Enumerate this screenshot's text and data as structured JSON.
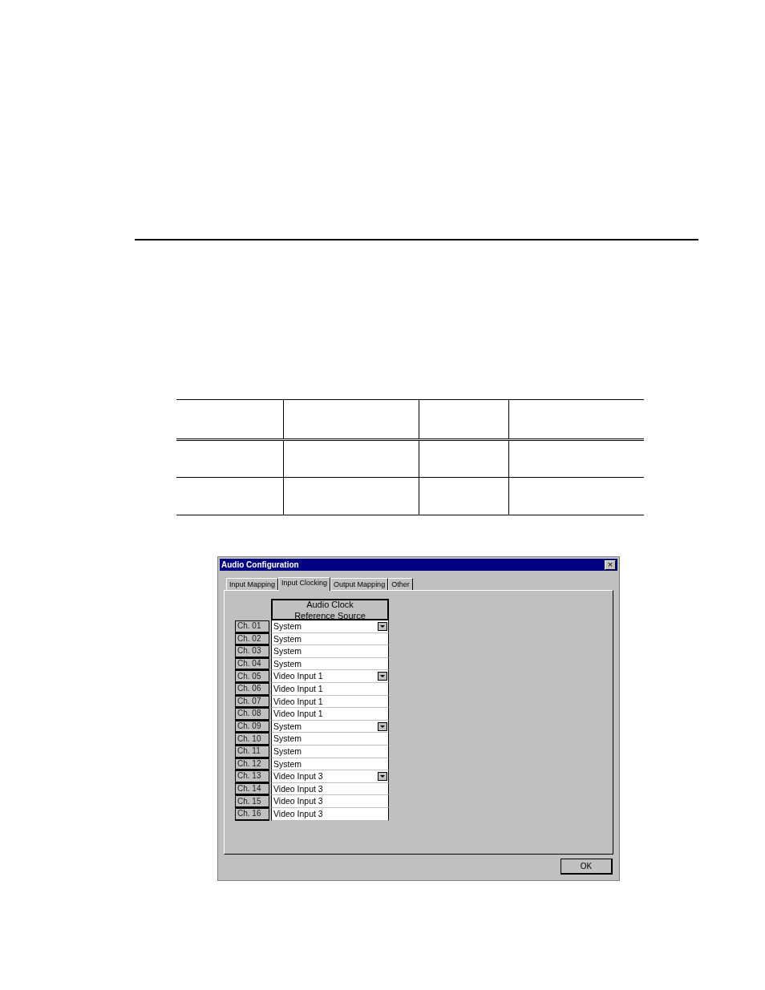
{
  "window": {
    "title": "Audio Configuration",
    "close": "×"
  },
  "tabs": [
    {
      "label": "Input Mapping",
      "selected": false
    },
    {
      "label": "Input Clocking",
      "selected": true
    },
    {
      "label": "Output Mapping",
      "selected": false
    },
    {
      "label": "Other",
      "selected": false
    }
  ],
  "column_header": "Audio Clock\nReference Source",
  "rows": [
    {
      "channel": "Ch. 01",
      "value": "System",
      "kind": "dropdown"
    },
    {
      "channel": "Ch. 02",
      "value": "System",
      "kind": "text"
    },
    {
      "channel": "Ch. 03",
      "value": "System",
      "kind": "text"
    },
    {
      "channel": "Ch. 04",
      "value": "System",
      "kind": "text"
    },
    {
      "channel": "Ch. 05",
      "value": "Video Input 1",
      "kind": "dropdown"
    },
    {
      "channel": "Ch. 06",
      "value": "Video Input 1",
      "kind": "text"
    },
    {
      "channel": "Ch. 07",
      "value": "Video Input 1",
      "kind": "text"
    },
    {
      "channel": "Ch. 08",
      "value": "Video Input 1",
      "kind": "text"
    },
    {
      "channel": "Ch. 09",
      "value": "System",
      "kind": "dropdown"
    },
    {
      "channel": "Ch. 10",
      "value": "System",
      "kind": "text"
    },
    {
      "channel": "Ch. 11",
      "value": "System",
      "kind": "text"
    },
    {
      "channel": "Ch. 12",
      "value": "System",
      "kind": "text"
    },
    {
      "channel": "Ch. 13",
      "value": "Video Input 3",
      "kind": "dropdown"
    },
    {
      "channel": "Ch. 14",
      "value": "Video Input 3",
      "kind": "text"
    },
    {
      "channel": "Ch. 15",
      "value": "Video Input 3",
      "kind": "text"
    },
    {
      "channel": "Ch. 16",
      "value": "Video Input 3",
      "kind": "text"
    }
  ],
  "buttons": [
    "OK"
  ]
}
